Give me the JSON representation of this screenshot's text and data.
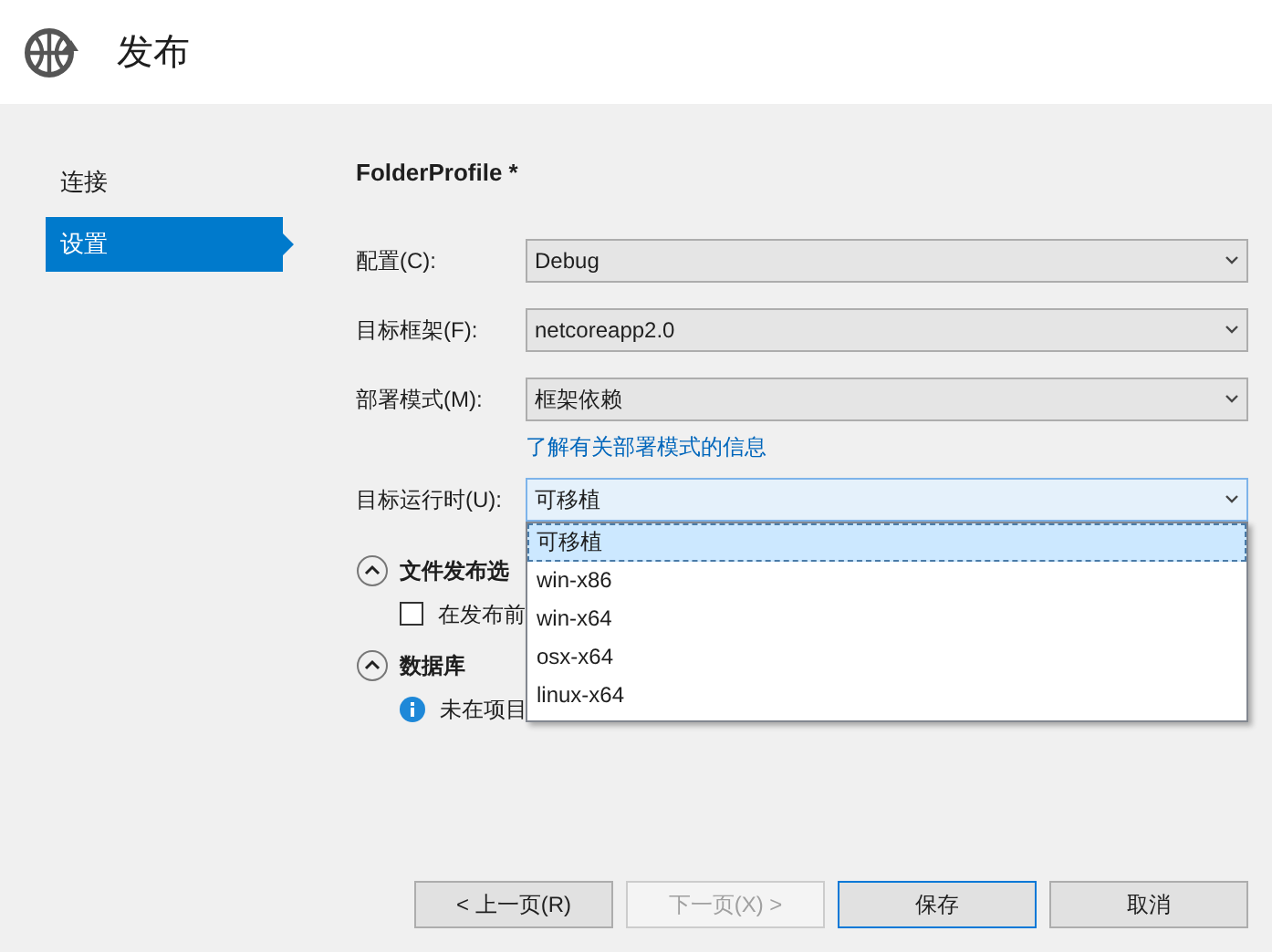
{
  "window": {
    "title": "发布"
  },
  "sidebar": {
    "items": [
      {
        "label": "连接",
        "selected": false
      },
      {
        "label": "设置",
        "selected": true
      }
    ]
  },
  "profile": {
    "title": "FolderProfile *"
  },
  "fields": [
    {
      "label": "配置(C):",
      "value": "Debug",
      "focused": false
    },
    {
      "label": "目标框架(F):",
      "value": "netcoreapp2.0",
      "focused": false
    },
    {
      "label": "部署模式(M):",
      "value": "框架依赖",
      "focused": false,
      "link": "了解有关部署模式的信息"
    },
    {
      "label": "目标运行时(U):",
      "value": "可移植",
      "focused": true
    }
  ],
  "dropdown": {
    "options": [
      {
        "label": "可移植",
        "selected": true
      },
      {
        "label": "win-x86",
        "selected": false
      },
      {
        "label": "win-x64",
        "selected": false
      },
      {
        "label": "osx-x64",
        "selected": false
      },
      {
        "label": "linux-x64",
        "selected": false
      }
    ]
  },
  "sections": [
    {
      "title": "文件发布选",
      "expanded": true,
      "items": [
        {
          "kind": "checkbox",
          "label": "在发布前",
          "checked": false
        }
      ]
    },
    {
      "title": "数据库",
      "expanded": true,
      "items": [
        {
          "kind": "info",
          "label": "未在项目"
        }
      ]
    }
  ],
  "buttons": [
    {
      "label": "< 上一页(R)",
      "disabled": false,
      "default": false
    },
    {
      "label": "下一页(X) >",
      "disabled": true,
      "default": false
    },
    {
      "label": "保存",
      "disabled": false,
      "default": true
    },
    {
      "label": "取消",
      "disabled": false,
      "default": false
    }
  ]
}
